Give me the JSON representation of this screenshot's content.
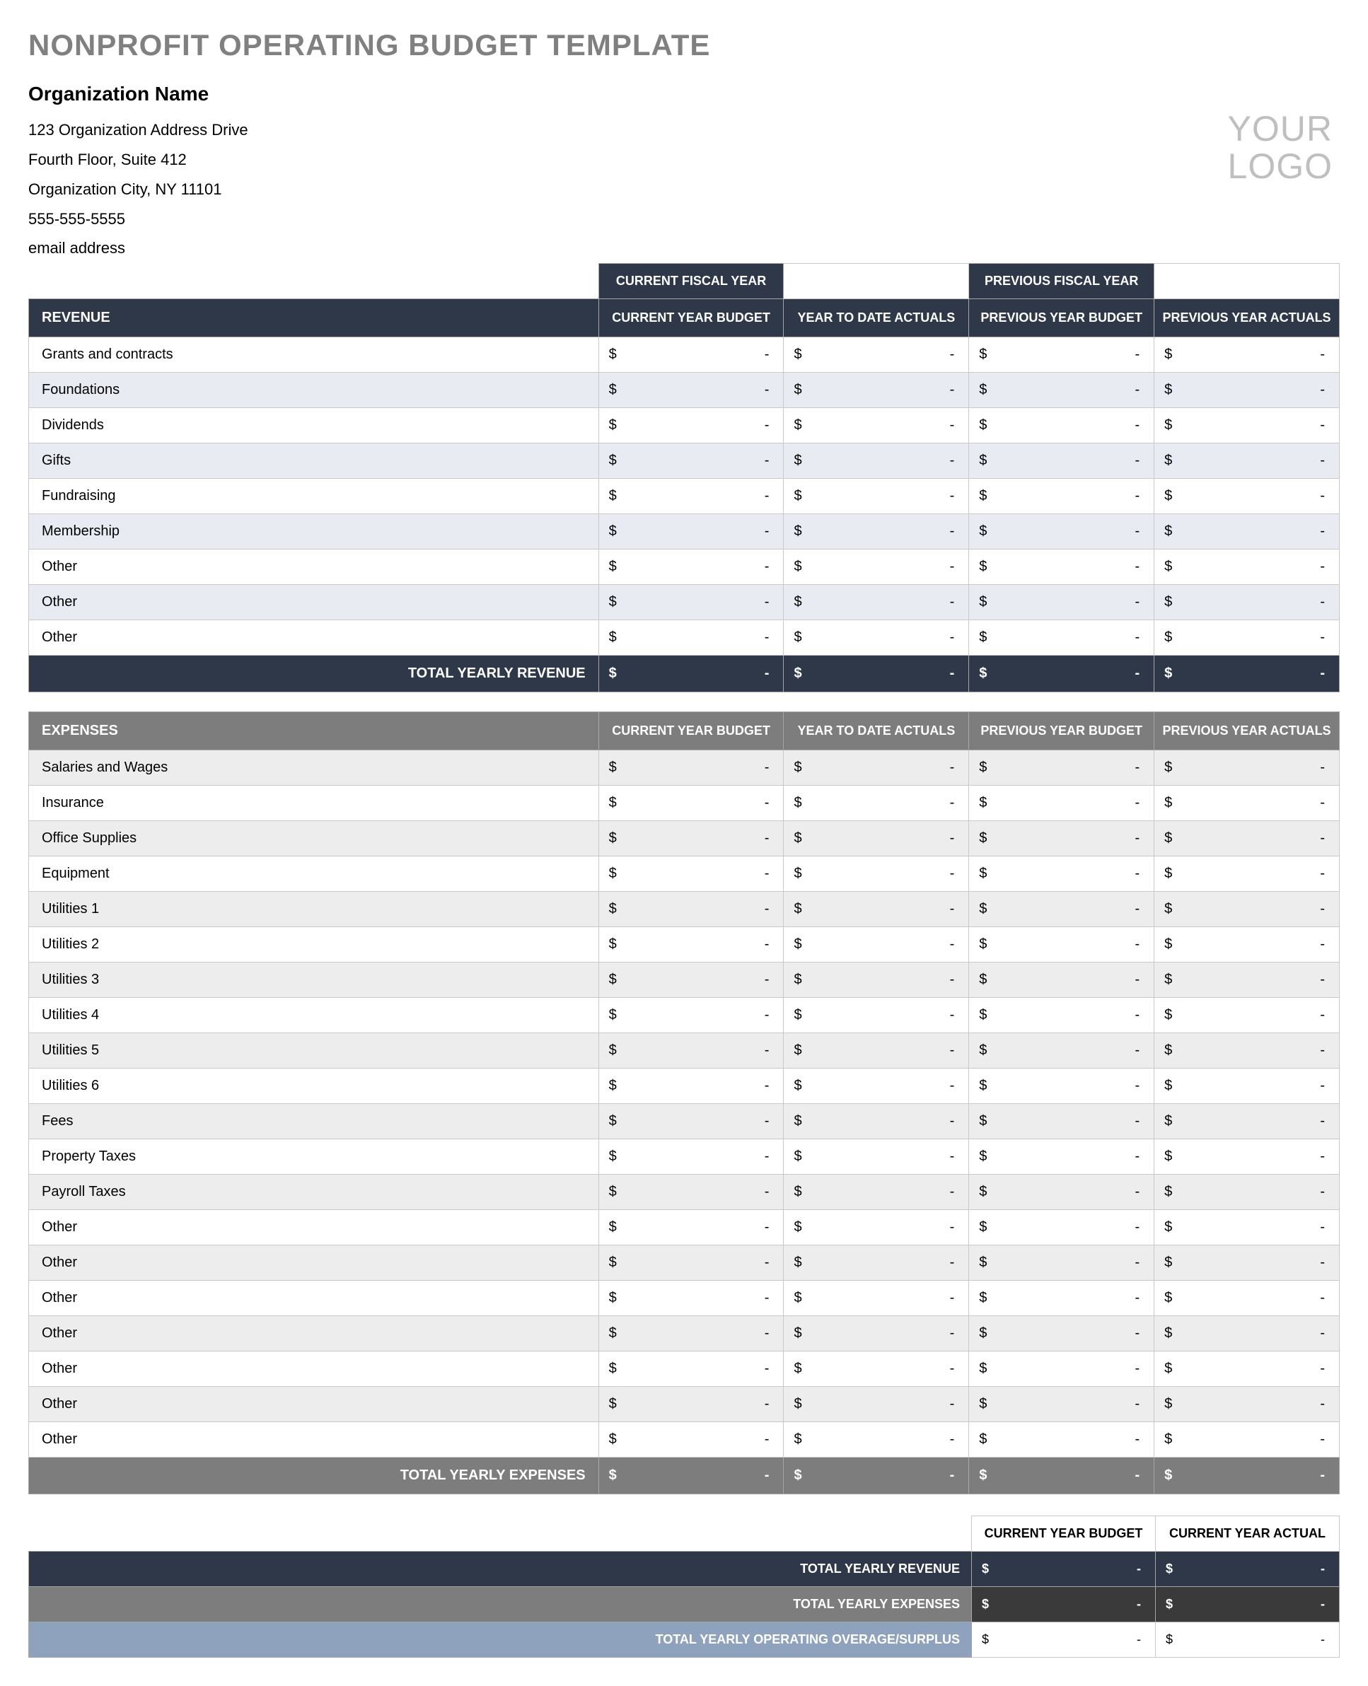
{
  "title": "NONPROFIT OPERATING BUDGET TEMPLATE",
  "org": {
    "name": "Organization Name",
    "addr1": "123 Organization Address Drive",
    "addr2": "Fourth Floor, Suite 412",
    "city": "Organization City, NY  11101",
    "phone": "555-555-5555",
    "email": "email address"
  },
  "logo": {
    "line1": "YOUR",
    "line2": "LOGO"
  },
  "fy": {
    "current_label": "CURRENT FISCAL YEAR",
    "current_value": "",
    "previous_label": "PREVIOUS FISCAL YEAR",
    "previous_value": ""
  },
  "columns": {
    "c1": "CURRENT YEAR BUDGET",
    "c2": "YEAR TO DATE ACTUALS",
    "c3": "PREVIOUS YEAR BUDGET",
    "c4": "PREVIOUS YEAR ACTUALS"
  },
  "currency": "$",
  "dash": "-",
  "revenue": {
    "header": "REVENUE",
    "total_label": "TOTAL YEARLY REVENUE",
    "rows": [
      {
        "label": "Grants and contracts",
        "c1": "-",
        "c2": "-",
        "c3": "-",
        "c4": "-"
      },
      {
        "label": "Foundations",
        "c1": "-",
        "c2": "-",
        "c3": "-",
        "c4": "-"
      },
      {
        "label": "Dividends",
        "c1": "-",
        "c2": "-",
        "c3": "-",
        "c4": "-"
      },
      {
        "label": "Gifts",
        "c1": "-",
        "c2": "-",
        "c3": "-",
        "c4": "-"
      },
      {
        "label": "Fundraising",
        "c1": "-",
        "c2": "-",
        "c3": "-",
        "c4": "-"
      },
      {
        "label": "Membership",
        "c1": "-",
        "c2": "-",
        "c3": "-",
        "c4": "-"
      },
      {
        "label": "Other",
        "c1": "-",
        "c2": "-",
        "c3": "-",
        "c4": "-"
      },
      {
        "label": "Other",
        "c1": "-",
        "c2": "-",
        "c3": "-",
        "c4": "-"
      },
      {
        "label": "Other",
        "c1": "-",
        "c2": "-",
        "c3": "-",
        "c4": "-"
      }
    ],
    "total": {
      "c1": "-",
      "c2": "-",
      "c3": "-",
      "c4": "-"
    }
  },
  "expenses": {
    "header": "EXPENSES",
    "total_label": "TOTAL YEARLY EXPENSES",
    "rows": [
      {
        "label": "Salaries and Wages",
        "c1": "-",
        "c2": "-",
        "c3": "-",
        "c4": "-"
      },
      {
        "label": "Insurance",
        "c1": "-",
        "c2": "-",
        "c3": "-",
        "c4": "-"
      },
      {
        "label": "Office Supplies",
        "c1": "-",
        "c2": "-",
        "c3": "-",
        "c4": "-"
      },
      {
        "label": "Equipment",
        "c1": "-",
        "c2": "-",
        "c3": "-",
        "c4": "-"
      },
      {
        "label": "Utilities 1",
        "c1": "-",
        "c2": "-",
        "c3": "-",
        "c4": "-"
      },
      {
        "label": "Utilities 2",
        "c1": "-",
        "c2": "-",
        "c3": "-",
        "c4": "-"
      },
      {
        "label": "Utilities 3",
        "c1": "-",
        "c2": "-",
        "c3": "-",
        "c4": "-"
      },
      {
        "label": "Utilities 4",
        "c1": "-",
        "c2": "-",
        "c3": "-",
        "c4": "-"
      },
      {
        "label": "Utilities 5",
        "c1": "-",
        "c2": "-",
        "c3": "-",
        "c4": "-"
      },
      {
        "label": "Utilities 6",
        "c1": "-",
        "c2": "-",
        "c3": "-",
        "c4": "-"
      },
      {
        "label": "Fees",
        "c1": "-",
        "c2": "-",
        "c3": "-",
        "c4": "-"
      },
      {
        "label": "Property Taxes",
        "c1": "-",
        "c2": "-",
        "c3": "-",
        "c4": "-"
      },
      {
        "label": "Payroll Taxes",
        "c1": "-",
        "c2": "-",
        "c3": "-",
        "c4": "-"
      },
      {
        "label": "Other",
        "c1": "-",
        "c2": "-",
        "c3": "-",
        "c4": "-"
      },
      {
        "label": "Other",
        "c1": "-",
        "c2": "-",
        "c3": "-",
        "c4": "-"
      },
      {
        "label": "Other",
        "c1": "-",
        "c2": "-",
        "c3": "-",
        "c4": "-"
      },
      {
        "label": "Other",
        "c1": "-",
        "c2": "-",
        "c3": "-",
        "c4": "-"
      },
      {
        "label": "Other",
        "c1": "-",
        "c2": "-",
        "c3": "-",
        "c4": "-"
      },
      {
        "label": "Other",
        "c1": "-",
        "c2": "-",
        "c3": "-",
        "c4": "-"
      },
      {
        "label": "Other",
        "c1": "-",
        "c2": "-",
        "c3": "-",
        "c4": "-"
      }
    ],
    "total": {
      "c1": "-",
      "c2": "-",
      "c3": "-",
      "c4": "-"
    }
  },
  "summary": {
    "col1": "CURRENT YEAR BUDGET",
    "col2": "CURRENT YEAR ACTUAL",
    "rev_label": "TOTAL YEARLY REVENUE",
    "exp_label": "TOTAL YEARLY EXPENSES",
    "net_label": "TOTAL YEARLY OPERATING OVERAGE/SURPLUS",
    "rev": {
      "c1": "-",
      "c2": "-"
    },
    "exp": {
      "c1": "-",
      "c2": "-"
    },
    "net": {
      "c1": "-",
      "c2": "-"
    }
  }
}
